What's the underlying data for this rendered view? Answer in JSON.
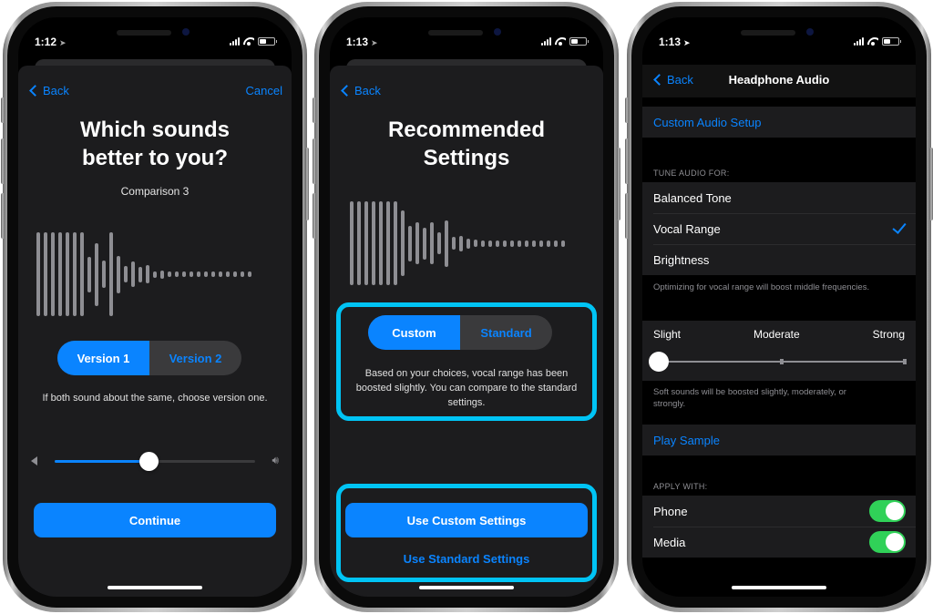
{
  "colors": {
    "accent": "#0a84ff",
    "highlight": "#00c4f5",
    "toggle_on": "#30d158",
    "sheet_bg": "#1c1c1e"
  },
  "phone1": {
    "status": {
      "time": "1:12",
      "location_icon": "location-arrow-icon"
    },
    "nav": {
      "back_label": "Back",
      "cancel_label": "Cancel"
    },
    "title_line1": "Which sounds",
    "title_line2": "better to you?",
    "subtitle": "Comparison 3",
    "waveform_heights": [
      1.0,
      1.0,
      1.0,
      1.0,
      1.0,
      1.0,
      1.0,
      0.42,
      0.75,
      0.33,
      1.0,
      0.45,
      0.2,
      0.3,
      0.18,
      0.22,
      0.08,
      0.1,
      0.07,
      0.07,
      0.07,
      0.07,
      0.07,
      0.07,
      0.07,
      0.07,
      0.07,
      0.07,
      0.07,
      0.07
    ],
    "segments": [
      {
        "label": "Version 1",
        "selected": true
      },
      {
        "label": "Version 2",
        "selected": false
      }
    ],
    "note": "If both sound about the same, choose version one.",
    "volume_fraction": 0.47,
    "continue_label": "Continue"
  },
  "phone2": {
    "status": {
      "time": "1:13",
      "location_icon": "location-arrow-icon"
    },
    "nav": {
      "back_label": "Back"
    },
    "title_line1": "Recommended",
    "title_line2": "Settings",
    "waveform_heights": [
      1.0,
      1.0,
      1.0,
      1.0,
      1.0,
      1.0,
      1.0,
      0.78,
      0.42,
      0.5,
      0.38,
      0.5,
      0.26,
      0.55,
      0.15,
      0.18,
      0.12,
      0.09,
      0.08,
      0.08,
      0.08,
      0.08,
      0.08,
      0.08,
      0.08,
      0.08,
      0.08,
      0.08,
      0.08,
      0.08
    ],
    "segments": [
      {
        "label": "Custom",
        "selected": true
      },
      {
        "label": "Standard",
        "selected": false
      }
    ],
    "note": "Based on your choices, vocal range has been boosted slightly. You can compare to the standard settings.",
    "primary_label": "Use Custom Settings",
    "secondary_label": "Use Standard Settings"
  },
  "phone3": {
    "status": {
      "time": "1:13",
      "location_icon": "location-arrow-icon"
    },
    "nav": {
      "back_label": "Back",
      "title": "Headphone Audio"
    },
    "custom_audio_setup": "Custom Audio Setup",
    "tune_header": "TUNE AUDIO FOR:",
    "tune_options": [
      {
        "label": "Balanced Tone",
        "selected": false
      },
      {
        "label": "Vocal Range",
        "selected": true
      },
      {
        "label": "Brightness",
        "selected": false
      }
    ],
    "tune_footer": "Optimizing for vocal range will boost middle frequencies.",
    "boost_labels": [
      "Slight",
      "Moderate",
      "Strong"
    ],
    "boost_value": "Slight",
    "boost_footer": "Soft sounds will be boosted slightly, moderately, or strongly.",
    "play_sample": "Play Sample",
    "apply_header": "APPLY WITH:",
    "apply_options": [
      {
        "label": "Phone",
        "on": true
      },
      {
        "label": "Media",
        "on": true
      }
    ]
  }
}
